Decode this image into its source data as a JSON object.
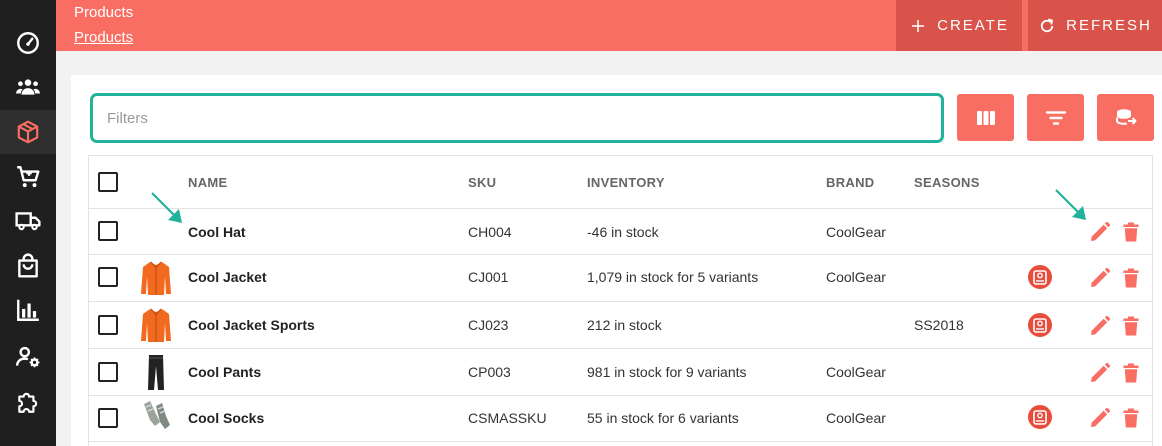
{
  "header": {
    "title": "Products",
    "breadcrumb": "Products",
    "create_label": "CREATE",
    "refresh_label": "REFRESH"
  },
  "colors": {
    "accent": "#f96e63",
    "accent_dark": "#d9534a",
    "filter_border": "#21b39a",
    "sidebar": "#1f1f1f"
  },
  "sidebar": {
    "items": [
      {
        "icon": "dashboard-icon"
      },
      {
        "icon": "customers-icon"
      },
      {
        "icon": "products-icon",
        "active": true
      },
      {
        "icon": "cart-icon"
      },
      {
        "icon": "shipping-icon"
      },
      {
        "icon": "bag-icon"
      },
      {
        "icon": "reports-icon"
      },
      {
        "icon": "user-settings-icon"
      },
      {
        "icon": "extensions-icon"
      }
    ]
  },
  "filters": {
    "placeholder": "Filters"
  },
  "toolbar": [
    "columns-icon",
    "filter-icon",
    "export-icon"
  ],
  "table": {
    "columns": [
      "NAME",
      "SKU",
      "INVENTORY",
      "BRAND",
      "SEASONS"
    ],
    "rows": [
      {
        "name": "Cool Hat",
        "sku": "CH004",
        "inventory": "-46 in stock",
        "brand": "CoolGear",
        "seasons": "",
        "image": "",
        "badge": false
      },
      {
        "name": "Cool Jacket",
        "sku": "CJ001",
        "inventory": "1,079 in stock for 5 variants",
        "brand": "CoolGear",
        "seasons": "",
        "image": "jacket",
        "badge": true
      },
      {
        "name": "Cool Jacket Sports",
        "sku": "CJ023",
        "inventory": "212 in stock",
        "brand": "",
        "seasons": "SS2018",
        "image": "jacket",
        "badge": true
      },
      {
        "name": "Cool Pants",
        "sku": "CP003",
        "inventory": "981 in stock for 9 variants",
        "brand": "CoolGear",
        "seasons": "",
        "image": "pants",
        "badge": false
      },
      {
        "name": "Cool Socks",
        "sku": "CSMASSKU",
        "inventory": "55 in stock for 6 variants",
        "brand": "CoolGear",
        "seasons": "",
        "image": "socks",
        "badge": true
      }
    ]
  }
}
